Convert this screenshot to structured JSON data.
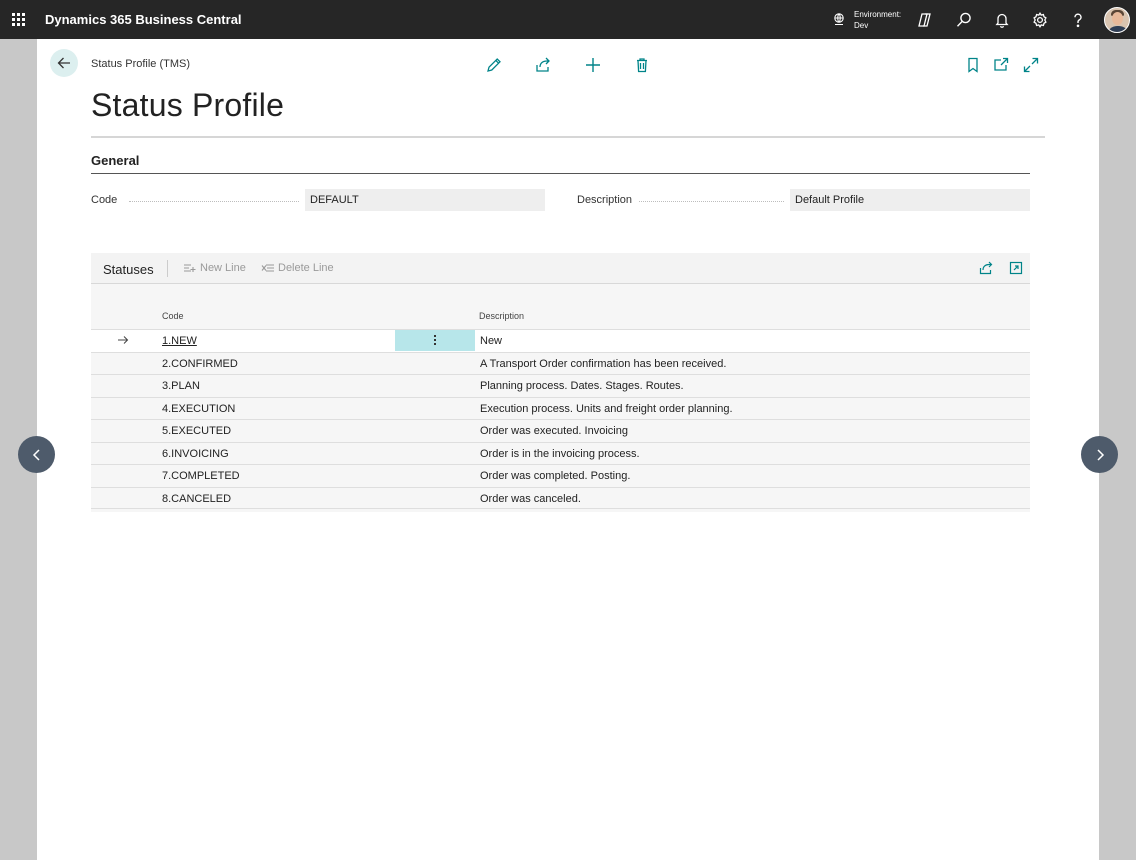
{
  "app": {
    "title": "Dynamics 365 Business Central"
  },
  "environment": {
    "label": "Environment:",
    "value": "Dev"
  },
  "breadcrumb": "Status Profile (TMS)",
  "page_title": "Status Profile",
  "general": {
    "section_title": "General",
    "code_label": "Code",
    "code_value": "DEFAULT",
    "description_label": "Description",
    "description_value": "Default Profile"
  },
  "statuses": {
    "title": "Statuses",
    "new_line": "New Line",
    "delete_line": "Delete Line",
    "columns": {
      "code": "Code",
      "description": "Description"
    },
    "rows": [
      {
        "code": "1.NEW",
        "description": "New"
      },
      {
        "code": "2.CONFIRMED",
        "description": "A Transport Order confirmation has been received."
      },
      {
        "code": "3.PLAN",
        "description": "Planning process. Dates. Stages. Routes."
      },
      {
        "code": "4.EXECUTION",
        "description": "Execution process. Units and freight order planning."
      },
      {
        "code": "5.EXECUTED",
        "description": "Order was executed. Invoicing"
      },
      {
        "code": "6.INVOICING",
        "description": "Order is in the invoicing process."
      },
      {
        "code": "7.COMPLETED",
        "description": "Order was completed. Posting."
      },
      {
        "code": "8.CANCELED",
        "description": "Order was canceled."
      }
    ]
  },
  "colors": {
    "accent": "#008489",
    "topbar": "#262626",
    "selected_cell": "#b7e6ea"
  }
}
